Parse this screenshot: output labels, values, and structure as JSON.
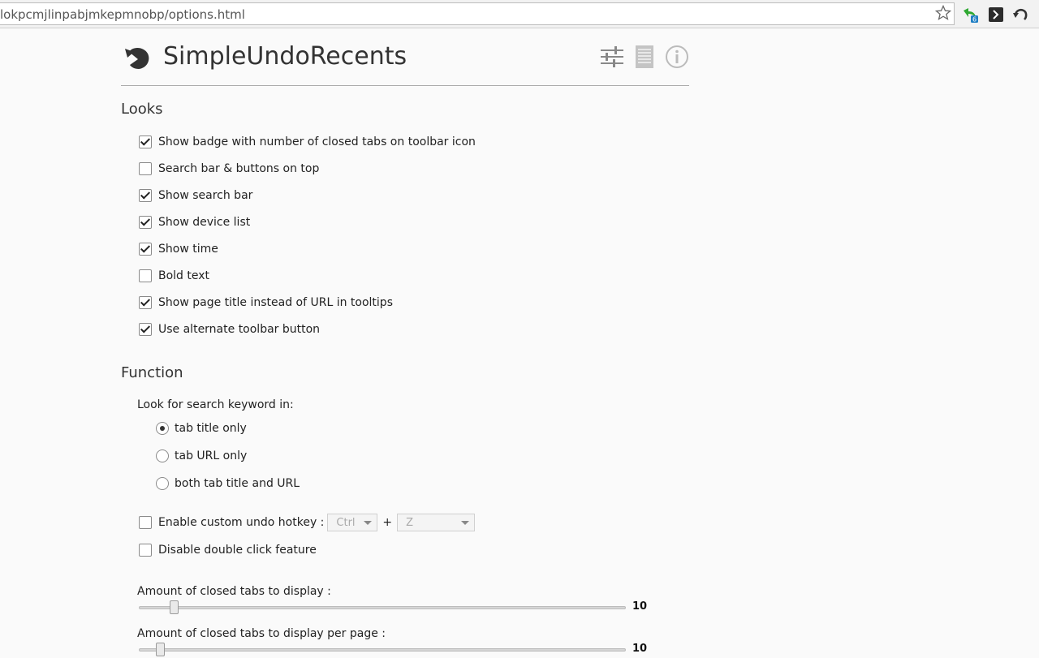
{
  "browser": {
    "url": "lokpcmjlinpabjmkepmnobp/options.html",
    "icons": [
      "bookmark-star-icon",
      "extension-badge-icon",
      "extension-dark-icon",
      "undo-extension-icon"
    ],
    "badge_count": "6"
  },
  "header": {
    "title": "SimpleUndoRecents",
    "icons": [
      "settings-sliders-icon",
      "list-icon",
      "info-icon"
    ]
  },
  "looks": {
    "title": "Looks",
    "options": [
      {
        "label": "Show badge with number of closed tabs on toolbar icon",
        "checked": true
      },
      {
        "label": "Search bar & buttons on top",
        "checked": false
      },
      {
        "label": "Show search bar",
        "checked": true
      },
      {
        "label": "Show device list",
        "checked": true
      },
      {
        "label": "Show time",
        "checked": true
      },
      {
        "label": "Bold text",
        "checked": false
      },
      {
        "label": "Show page title instead of URL in tooltips",
        "checked": true
      },
      {
        "label": "Use alternate toolbar button",
        "checked": true
      }
    ]
  },
  "function": {
    "title": "Function",
    "search_label": "Look for search keyword in:",
    "radios": [
      {
        "label": "tab title only",
        "selected": true
      },
      {
        "label": "tab URL only",
        "selected": false
      },
      {
        "label": "both tab title and URL",
        "selected": false
      }
    ],
    "hotkey": {
      "label": "Enable custom undo hotkey :",
      "checked": false,
      "modifier": "Ctrl",
      "plus": "+",
      "key": "Z"
    },
    "double_click": {
      "label": "Disable double click feature",
      "checked": false
    },
    "sliders": [
      {
        "label": "Amount of closed tabs to display :",
        "value": "10",
        "fraction": 0.065
      },
      {
        "label": "Amount of closed tabs to display per page :",
        "value": "10",
        "fraction": 0.035
      }
    ]
  }
}
